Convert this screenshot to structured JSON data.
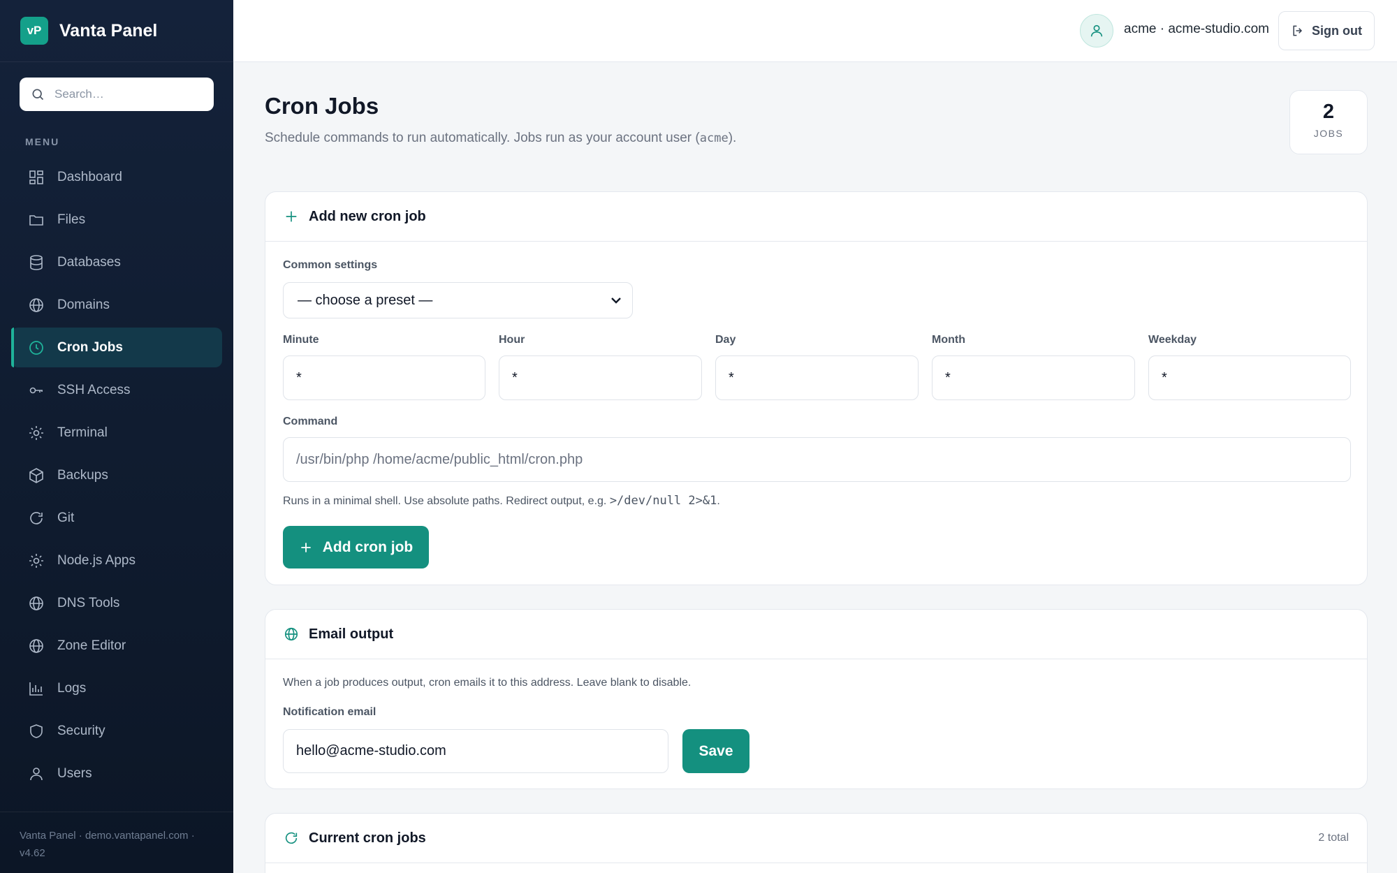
{
  "app": {
    "logo_text": "vP",
    "name": "Vanta Panel"
  },
  "search": {
    "placeholder": "Search…"
  },
  "sidebar": {
    "menu_label": "MENU",
    "items": [
      {
        "label": "Dashboard",
        "icon": "dashboard-icon"
      },
      {
        "label": "Files",
        "icon": "folder-icon"
      },
      {
        "label": "Databases",
        "icon": "database-icon"
      },
      {
        "label": "Domains",
        "icon": "globe-icon"
      },
      {
        "label": "Cron Jobs",
        "icon": "clock-icon",
        "active": true
      },
      {
        "label": "SSH Access",
        "icon": "key-icon"
      },
      {
        "label": "Terminal",
        "icon": "sun-icon"
      },
      {
        "label": "Backups",
        "icon": "box-icon"
      },
      {
        "label": "Git",
        "icon": "refresh-icon"
      },
      {
        "label": "Node.js Apps",
        "icon": "sun-icon"
      },
      {
        "label": "DNS Tools",
        "icon": "globe-icon"
      },
      {
        "label": "Zone Editor",
        "icon": "globe-icon"
      },
      {
        "label": "Logs",
        "icon": "bar-chart-icon"
      },
      {
        "label": "Security",
        "icon": "shield-icon"
      },
      {
        "label": "Users",
        "icon": "user-icon"
      }
    ],
    "footer": {
      "line1": "Vanta Panel · demo.vantapanel.com ·",
      "line2": "v4.62"
    }
  },
  "topbar": {
    "account": "acme · acme-studio.com",
    "sign_out": "Sign out"
  },
  "page": {
    "title": "Cron Jobs",
    "subtitle_before": "Schedule commands to run automatically. Jobs run as your account user (",
    "subtitle_code": "acme",
    "subtitle_after": ").",
    "jobs_count": "2",
    "jobs_label": "JOBS"
  },
  "add_card": {
    "title": "Add new cron job",
    "common_settings_label": "Common settings",
    "preset_value": "— choose a preset —",
    "fields": [
      {
        "label": "Minute",
        "value": "*"
      },
      {
        "label": "Hour",
        "value": "*"
      },
      {
        "label": "Day",
        "value": "*"
      },
      {
        "label": "Month",
        "value": "*"
      },
      {
        "label": "Weekday",
        "value": "*"
      }
    ],
    "command_label": "Command",
    "command_placeholder": "/usr/bin/php /home/acme/public_html/cron.php",
    "hint_text": "Runs in a minimal shell. Use absolute paths. Redirect output, e.g.",
    "hint_code": ">/dev/null 2>&1",
    "hint_end": ".",
    "button": "Add cron job"
  },
  "email_card": {
    "title": "Email output",
    "description": "When a job produces output, cron emails it to this address. Leave blank to disable.",
    "label": "Notification email",
    "value": "hello@acme-studio.com",
    "save": "Save"
  },
  "current_card": {
    "title": "Current cron jobs",
    "total": "2 total"
  },
  "colors": {
    "accent": "#14907f",
    "sidebar_bg": "#14223a",
    "active_bg": "#13394a"
  }
}
